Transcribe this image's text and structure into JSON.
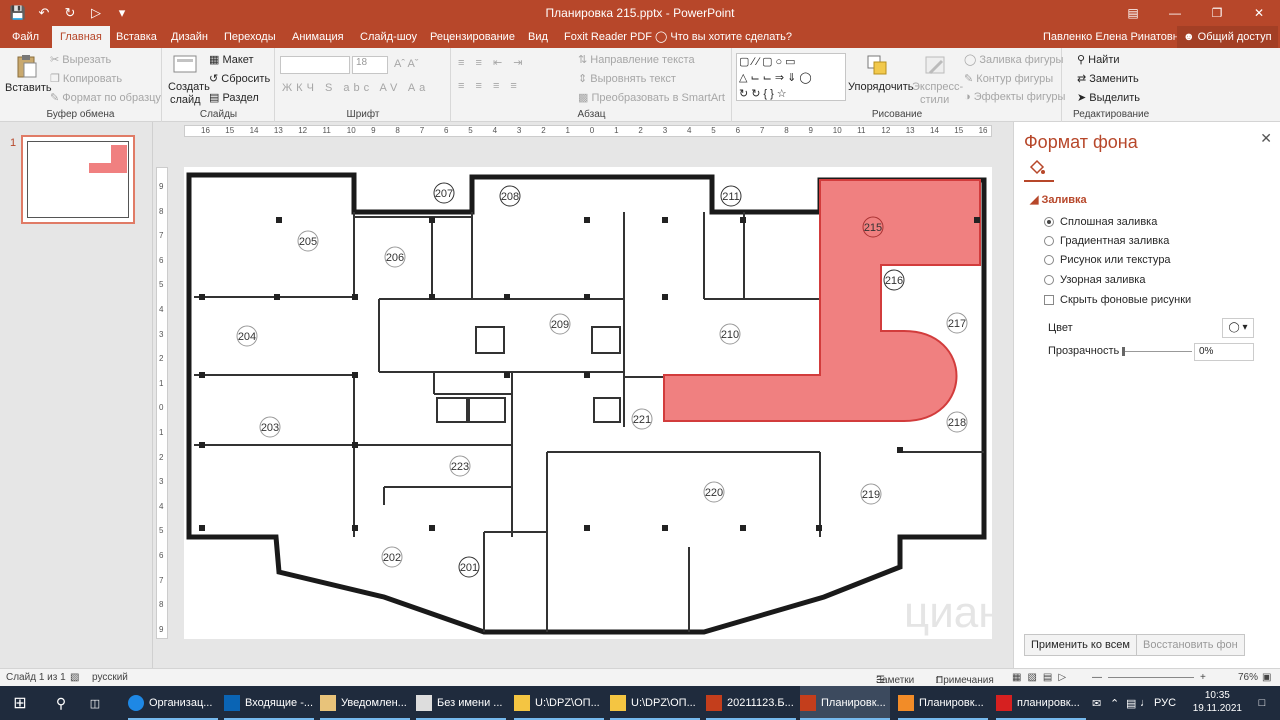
{
  "window": {
    "title": "Планировка 215.pptx - PowerPoint",
    "user": "Павленко Елена Ринатовна",
    "share": "Общий доступ"
  },
  "tabs": [
    "Файл",
    "Главная",
    "Вставка",
    "Дизайн",
    "Переходы",
    "Анимация",
    "Слайд-шоу",
    "Рецензирование",
    "Вид",
    "Foxit Reader PDF"
  ],
  "tell_me": "Что вы хотите сделать?",
  "ribbon": {
    "clipboard": {
      "label": "Буфер обмена",
      "paste": "Вставить",
      "cut": "Вырезать",
      "copy": "Копировать",
      "format_painter": "Формат по образцу"
    },
    "slides": {
      "label": "Слайды",
      "new_slide_1": "Создать",
      "new_slide_2": "слайд",
      "layout": "Макет",
      "reset": "Сбросить",
      "section": "Раздел"
    },
    "font": {
      "label": "Шрифт",
      "size": "18"
    },
    "paragraph": {
      "label": "Абзац",
      "text_direction": "Направление текста",
      "align_text": "Выровнять текст",
      "smartart": "Преобразовать в SmartArt"
    },
    "drawing": {
      "label": "Рисование",
      "arrange": "Упорядочить",
      "quick_styles_1": "Экспресс-",
      "quick_styles_2": "стили",
      "shape_fill": "Заливка фигуры",
      "shape_outline": "Контур фигуры",
      "shape_effects": "Эффекты фигуры"
    },
    "editing": {
      "label": "Редактирование",
      "find": "Найти",
      "replace": "Заменить",
      "select": "Выделить"
    }
  },
  "slide_panel": {
    "number": "1"
  },
  "rulers": {
    "horizontal": [
      "16",
      "15",
      "14",
      "13",
      "12",
      "11",
      "10",
      "9",
      "8",
      "7",
      "6",
      "5",
      "4",
      "3",
      "2",
      "1",
      "0",
      "1",
      "2",
      "3",
      "4",
      "5",
      "6",
      "7",
      "8",
      "9",
      "10",
      "11",
      "12",
      "13",
      "14",
      "15",
      "16"
    ],
    "vertical": [
      "9",
      "8",
      "7",
      "6",
      "5",
      "4",
      "3",
      "2",
      "1",
      "0",
      "1",
      "2",
      "3",
      "4",
      "5",
      "6",
      "7",
      "8",
      "9"
    ]
  },
  "floorplan": {
    "highlight_color": "#f08080",
    "rooms": [
      "201",
      "202",
      "203",
      "204",
      "205",
      "206",
      "207",
      "208",
      "209",
      "210",
      "211",
      "215",
      "216",
      "217",
      "218",
      "219",
      "220",
      "221",
      "223"
    ],
    "watermark": "циан"
  },
  "format_pane": {
    "title": "Формат фона",
    "section": "Заливка",
    "options": [
      "Сплошная заливка",
      "Градиентная заливка",
      "Рисунок или текстура",
      "Узорная заливка"
    ],
    "selected_option": "Сплошная заливка",
    "hide_bg": "Скрыть фоновые рисунки",
    "color_label": "Цвет",
    "transparency_label": "Прозрачность",
    "transparency_value": "0%",
    "apply_all": "Применить ко всем",
    "reset_bg": "Восстановить фон"
  },
  "status": {
    "slide": "Слайд 1 из 1",
    "lang": "русский",
    "notes": "Заметки",
    "comments": "Примечания",
    "zoom": "76%"
  },
  "taskbar": {
    "items": [
      "Организац...",
      "Входящие -...",
      "Уведомлен...",
      "Без имени ...",
      "U:\\DPZ\\ОП...",
      "U:\\DPZ\\ОП...",
      "20211123.Б...",
      "Планировк...",
      "Планировк...",
      "планировк..."
    ],
    "lang": "РУС",
    "time": "10:35",
    "date": "19.11.2021"
  }
}
